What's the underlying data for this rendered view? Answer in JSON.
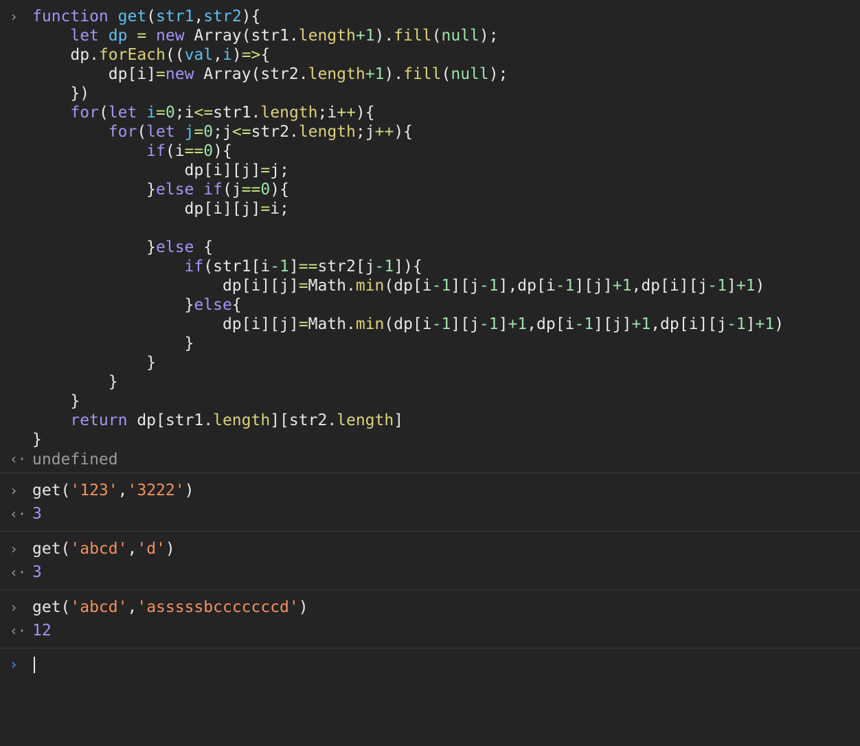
{
  "prompt_glyph": "›",
  "result_glyph": "‹·",
  "code_lines": [
    [
      {
        "t": "function ",
        "c": "kw"
      },
      {
        "t": "get",
        "c": "fn"
      },
      {
        "t": "(",
        "c": "pl"
      },
      {
        "t": "str1",
        "c": "fn"
      },
      {
        "t": ",",
        "c": "pl"
      },
      {
        "t": "str2",
        "c": "fn"
      },
      {
        "t": "){",
        "c": "pl"
      }
    ],
    [
      {
        "t": "    let ",
        "c": "kw"
      },
      {
        "t": "dp",
        "c": "fn"
      },
      {
        "t": " = ",
        "c": "op"
      },
      {
        "t": "new ",
        "c": "kw"
      },
      {
        "t": "Array(str1.",
        "c": "pl"
      },
      {
        "t": "length",
        "c": "prop"
      },
      {
        "t": "+1",
        "c": "num"
      },
      {
        "t": ").",
        "c": "pl"
      },
      {
        "t": "fill",
        "c": "prop"
      },
      {
        "t": "(",
        "c": "pl"
      },
      {
        "t": "null",
        "c": "num"
      },
      {
        "t": ");",
        "c": "pl"
      }
    ],
    [
      {
        "t": "    dp.",
        "c": "pl"
      },
      {
        "t": "forEach",
        "c": "prop"
      },
      {
        "t": "((",
        "c": "pl"
      },
      {
        "t": "val",
        "c": "fn"
      },
      {
        "t": ",",
        "c": "pl"
      },
      {
        "t": "i",
        "c": "fn"
      },
      {
        "t": ")",
        "c": "pl"
      },
      {
        "t": "=>",
        "c": "op"
      },
      {
        "t": "{",
        "c": "pl"
      }
    ],
    [
      {
        "t": "        dp[i]",
        "c": "pl"
      },
      {
        "t": "=",
        "c": "op"
      },
      {
        "t": "new ",
        "c": "kw"
      },
      {
        "t": "Array(str2.",
        "c": "pl"
      },
      {
        "t": "length",
        "c": "prop"
      },
      {
        "t": "+1",
        "c": "num"
      },
      {
        "t": ").",
        "c": "pl"
      },
      {
        "t": "fill",
        "c": "prop"
      },
      {
        "t": "(",
        "c": "pl"
      },
      {
        "t": "null",
        "c": "num"
      },
      {
        "t": ");",
        "c": "pl"
      }
    ],
    [
      {
        "t": "    })",
        "c": "pl"
      }
    ],
    [
      {
        "t": "    for",
        "c": "kw"
      },
      {
        "t": "(",
        "c": "pl"
      },
      {
        "t": "let ",
        "c": "kw"
      },
      {
        "t": "i",
        "c": "fn"
      },
      {
        "t": "=",
        "c": "op"
      },
      {
        "t": "0",
        "c": "num"
      },
      {
        "t": ";i",
        "c": "pl"
      },
      {
        "t": "<=",
        "c": "op"
      },
      {
        "t": "str1.",
        "c": "pl"
      },
      {
        "t": "length",
        "c": "prop"
      },
      {
        "t": ";i",
        "c": "pl"
      },
      {
        "t": "++",
        "c": "op"
      },
      {
        "t": "){",
        "c": "pl"
      }
    ],
    [
      {
        "t": "        for",
        "c": "kw"
      },
      {
        "t": "(",
        "c": "pl"
      },
      {
        "t": "let ",
        "c": "kw"
      },
      {
        "t": "j",
        "c": "fn"
      },
      {
        "t": "=",
        "c": "op"
      },
      {
        "t": "0",
        "c": "num"
      },
      {
        "t": ";j",
        "c": "pl"
      },
      {
        "t": "<=",
        "c": "op"
      },
      {
        "t": "str2.",
        "c": "pl"
      },
      {
        "t": "length",
        "c": "prop"
      },
      {
        "t": ";j",
        "c": "pl"
      },
      {
        "t": "++",
        "c": "op"
      },
      {
        "t": "){",
        "c": "pl"
      }
    ],
    [
      {
        "t": "            if",
        "c": "kw"
      },
      {
        "t": "(i",
        "c": "pl"
      },
      {
        "t": "==",
        "c": "op"
      },
      {
        "t": "0",
        "c": "num"
      },
      {
        "t": "){",
        "c": "pl"
      }
    ],
    [
      {
        "t": "                dp[i][j]",
        "c": "pl"
      },
      {
        "t": "=",
        "c": "op"
      },
      {
        "t": "j;",
        "c": "pl"
      }
    ],
    [
      {
        "t": "            }",
        "c": "pl"
      },
      {
        "t": "else if",
        "c": "kw"
      },
      {
        "t": "(j",
        "c": "pl"
      },
      {
        "t": "==",
        "c": "op"
      },
      {
        "t": "0",
        "c": "num"
      },
      {
        "t": "){",
        "c": "pl"
      }
    ],
    [
      {
        "t": "                dp[i][j]",
        "c": "pl"
      },
      {
        "t": "=",
        "c": "op"
      },
      {
        "t": "i;",
        "c": "pl"
      }
    ],
    [],
    [
      {
        "t": "            }",
        "c": "pl"
      },
      {
        "t": "else ",
        "c": "kw"
      },
      {
        "t": "{",
        "c": "pl"
      }
    ],
    [
      {
        "t": "                if",
        "c": "kw"
      },
      {
        "t": "(str1[i",
        "c": "pl"
      },
      {
        "t": "-1",
        "c": "num"
      },
      {
        "t": "]",
        "c": "pl"
      },
      {
        "t": "==",
        "c": "op"
      },
      {
        "t": "str2[j",
        "c": "pl"
      },
      {
        "t": "-1",
        "c": "num"
      },
      {
        "t": "]){",
        "c": "pl"
      }
    ],
    [
      {
        "t": "                    dp[i][j]",
        "c": "pl"
      },
      {
        "t": "=",
        "c": "op"
      },
      {
        "t": "Math.",
        "c": "pl"
      },
      {
        "t": "min",
        "c": "prop"
      },
      {
        "t": "(dp[i",
        "c": "pl"
      },
      {
        "t": "-1",
        "c": "num"
      },
      {
        "t": "][j",
        "c": "pl"
      },
      {
        "t": "-1",
        "c": "num"
      },
      {
        "t": "],dp[i",
        "c": "pl"
      },
      {
        "t": "-1",
        "c": "num"
      },
      {
        "t": "][j]",
        "c": "pl"
      },
      {
        "t": "+1",
        "c": "num"
      },
      {
        "t": ",dp[i][j",
        "c": "pl"
      },
      {
        "t": "-1",
        "c": "num"
      },
      {
        "t": "]",
        "c": "pl"
      },
      {
        "t": "+1",
        "c": "num"
      },
      {
        "t": ")",
        "c": "pl"
      }
    ],
    [
      {
        "t": "                }",
        "c": "pl"
      },
      {
        "t": "else",
        "c": "kw"
      },
      {
        "t": "{",
        "c": "pl"
      }
    ],
    [
      {
        "t": "                    dp[i][j]",
        "c": "pl"
      },
      {
        "t": "=",
        "c": "op"
      },
      {
        "t": "Math.",
        "c": "pl"
      },
      {
        "t": "min",
        "c": "prop"
      },
      {
        "t": "(dp[i",
        "c": "pl"
      },
      {
        "t": "-1",
        "c": "num"
      },
      {
        "t": "][j",
        "c": "pl"
      },
      {
        "t": "-1",
        "c": "num"
      },
      {
        "t": "]",
        "c": "pl"
      },
      {
        "t": "+1",
        "c": "num"
      },
      {
        "t": ",dp[i",
        "c": "pl"
      },
      {
        "t": "-1",
        "c": "num"
      },
      {
        "t": "][j]",
        "c": "pl"
      },
      {
        "t": "+1",
        "c": "num"
      },
      {
        "t": ",dp[i][j",
        "c": "pl"
      },
      {
        "t": "-1",
        "c": "num"
      },
      {
        "t": "]",
        "c": "pl"
      },
      {
        "t": "+1",
        "c": "num"
      },
      {
        "t": ")",
        "c": "pl"
      }
    ],
    [
      {
        "t": "                }",
        "c": "pl"
      }
    ],
    [
      {
        "t": "            }",
        "c": "pl"
      }
    ],
    [
      {
        "t": "        }",
        "c": "pl"
      }
    ],
    [
      {
        "t": "    }",
        "c": "pl"
      }
    ],
    [
      {
        "t": "    return ",
        "c": "kw"
      },
      {
        "t": "dp[str1.",
        "c": "pl"
      },
      {
        "t": "length",
        "c": "prop"
      },
      {
        "t": "][str2.",
        "c": "pl"
      },
      {
        "t": "length",
        "c": "prop"
      },
      {
        "t": "]",
        "c": "pl"
      }
    ],
    [
      {
        "t": "}",
        "c": "pl"
      }
    ]
  ],
  "first_result": "undefined",
  "calls": [
    {
      "input": [
        {
          "t": "get(",
          "c": "pl"
        },
        {
          "t": "'123'",
          "c": "str"
        },
        {
          "t": ",",
          "c": "pl"
        },
        {
          "t": "'3222'",
          "c": "str"
        },
        {
          "t": ")",
          "c": "pl"
        }
      ],
      "output": "3"
    },
    {
      "input": [
        {
          "t": "get(",
          "c": "pl"
        },
        {
          "t": "'abcd'",
          "c": "str"
        },
        {
          "t": ",",
          "c": "pl"
        },
        {
          "t": "'d'",
          "c": "str"
        },
        {
          "t": ")",
          "c": "pl"
        }
      ],
      "output": "3"
    },
    {
      "input": [
        {
          "t": "get(",
          "c": "pl"
        },
        {
          "t": "'abcd'",
          "c": "str"
        },
        {
          "t": ",",
          "c": "pl"
        },
        {
          "t": "'asssssbcccccccd'",
          "c": "str"
        },
        {
          "t": ")",
          "c": "pl"
        }
      ],
      "output": "12"
    }
  ]
}
